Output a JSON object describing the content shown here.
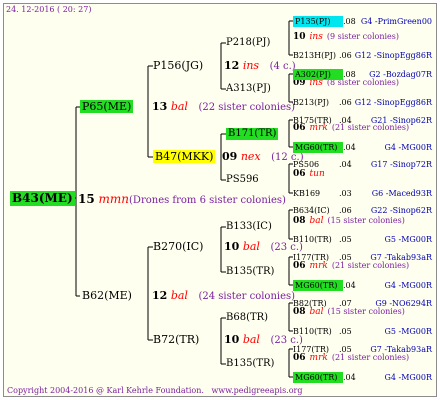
{
  "header": {
    "date": "24. 12-2016 ( 20: 27)"
  },
  "footer": {
    "copyright": "Copyright 2004-2016 @ Karl Kehrle Foundation.",
    "url": "www.pedigreeapis.org"
  },
  "root": {
    "label": "B43(ME)",
    "num": "15",
    "sym": "mmn",
    "note": "(Drones from 6 sister colonies)"
  },
  "gen1": {
    "upper": {
      "label": "P65(ME)",
      "num": "13",
      "sym": "bal",
      "note": "(22 sister colonies)"
    },
    "lower": {
      "label": "B62(ME)",
      "num": "12",
      "sym": "bal",
      "note": "(24 sister colonies)"
    }
  },
  "gen2": {
    "a": {
      "label": "P156(JG)",
      "num": "12",
      "sym": "ins",
      "note": "(4 c.)"
    },
    "b": {
      "label": "B47(MKK)",
      "num": "09",
      "sym": "nex",
      "note": "(12 c.)"
    },
    "c": {
      "label": "B270(IC)",
      "num": "10",
      "sym": "bal",
      "note": "(23 c.)"
    },
    "d": {
      "label": "B72(TR)",
      "num": "10",
      "sym": "bal",
      "note": "(23 c.)"
    }
  },
  "gen3": [
    {
      "label": "P218(PJ)",
      "num": "10",
      "sym": "ins",
      "note": "(9 sister colonies)"
    },
    {
      "label": "A313(PJ)",
      "num": "09",
      "sym": "ins",
      "note": "(8 sister colonies)"
    },
    {
      "label": "B171(TR)",
      "num": "06",
      "sym": "mrk",
      "note": "(21 sister colonies)"
    },
    {
      "label": "PS596",
      "num": "06",
      "sym": "tun",
      "note": ""
    },
    {
      "label": "B133(IC)",
      "num": "08",
      "sym": "bal",
      "note": "(15 sister colonies)"
    },
    {
      "label": "B135(TR)",
      "num": "06",
      "sym": "mrk",
      "note": "(21 sister colonies)"
    },
    {
      "label": "B68(TR)",
      "num": "08",
      "sym": "bal",
      "note": "(15 sister colonies)"
    },
    {
      "label": "B135(TR)",
      "num": "06",
      "sym": "mrk",
      "note": "(21 sister colonies)"
    }
  ],
  "gen4": [
    {
      "label": "P135(PJ)",
      "gn": ".08",
      "code": "G4 -PrimGreen00"
    },
    {
      "label": "B213H(PJ)",
      "gn": ".06",
      "code": "G12 -SinopEgg86R"
    },
    {
      "label": "A302(PJ)",
      "gn": ".08",
      "code": "G2 -Bozdag07R"
    },
    {
      "label": "B213(PJ)",
      "gn": ".06",
      "code": "G12 -SinopEgg86R"
    },
    {
      "label": "B175(TR)",
      "gn": ".04",
      "code": "G21 -Sinop62R"
    },
    {
      "label": "MG60(TR)",
      "gn": ".04",
      "code": "G4 -MG00R"
    },
    {
      "label": "PS506",
      "gn": ".04",
      "code": "G17 -Sinop72R"
    },
    {
      "label": "KB169",
      "gn": ".03",
      "code": "G6 -Maced93R"
    },
    {
      "label": "B634(IC)",
      "gn": ".06",
      "code": "G22 -Sinop62R"
    },
    {
      "label": "B110(TR)",
      "gn": ".05",
      "code": "G5 -MG00R"
    },
    {
      "label": "I177(TR)",
      "gn": ".05",
      "code": "G7 -Takab93aR"
    },
    {
      "label": "MG60(TR)",
      "gn": ".04",
      "code": "G4 -MG00R"
    },
    {
      "label": "B82(TR)",
      "gn": ".07",
      "code": "G9 -NO6294R"
    },
    {
      "label": "B110(TR)",
      "gn": ".05",
      "code": "G5 -MG00R"
    },
    {
      "label": "I177(TR)",
      "gn": ".05",
      "code": "G7 -Takab93aR"
    },
    {
      "label": "MG60(TR)",
      "gn": ".04",
      "code": "G4 -MG00R"
    }
  ],
  "colors": {
    "green": "#22dd22",
    "cyan": "#00e6ee",
    "yellow": "#ffff00",
    "blue": "#0000b0",
    "red": "#ff0000",
    "purple": "#7a1fa0"
  }
}
